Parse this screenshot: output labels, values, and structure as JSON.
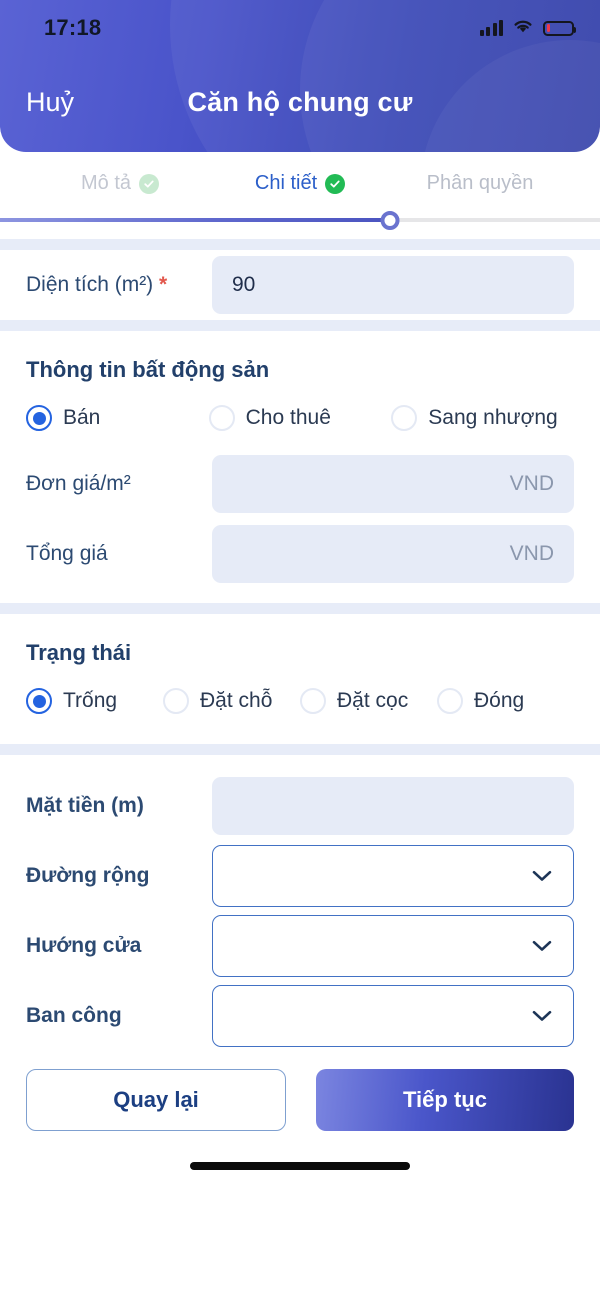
{
  "status_bar": {
    "time": "17:18",
    "signal_icon": "signal-bars-icon",
    "wifi_icon": "wifi-icon",
    "battery_icon": "battery-low-icon",
    "battery_level_percent": 14
  },
  "header": {
    "cancel_label": "Huỷ",
    "title": "Căn hộ chung cư",
    "gradient_from": "#5a63d4",
    "gradient_to": "#2b39a6"
  },
  "stepper": {
    "progress_percent": 65,
    "steps": [
      {
        "label": "Mô tả",
        "state": "done",
        "check_icon": "check-circle-icon"
      },
      {
        "label": "Chi tiết",
        "state": "active",
        "check_icon": "check-circle-icon"
      },
      {
        "label": "Phân quyền",
        "state": "todo",
        "check_icon": ""
      }
    ]
  },
  "area_section": {
    "label": "Diện tích (m²)",
    "required_mark": "*",
    "value": "90"
  },
  "property_section": {
    "title": "Thông tin bất động sản",
    "deal_type": {
      "selected": "Bán",
      "options": [
        {
          "label": "Bán",
          "selected": true
        },
        {
          "label": "Cho thuê",
          "selected": false
        },
        {
          "label": "Sang nhượng",
          "selected": false
        }
      ]
    },
    "fields": [
      {
        "label": "Đơn giá/m²",
        "value": "",
        "suffix": "VND"
      },
      {
        "label": "Tổng giá",
        "value": "",
        "suffix": "VND"
      }
    ]
  },
  "status_section": {
    "title": "Trạng thái",
    "selected": "Trống",
    "options": [
      {
        "label": "Trống",
        "selected": true
      },
      {
        "label": "Đặt chỗ",
        "selected": false
      },
      {
        "label": "Đặt cọc",
        "selected": false
      },
      {
        "label": "Đóng",
        "selected": false
      }
    ]
  },
  "detail_section": {
    "frontage": {
      "label": "Mặt tiền (m)",
      "value": ""
    },
    "selects": [
      {
        "label": "Đường rộng",
        "value": "",
        "icon": "chevron-down-icon"
      },
      {
        "label": "Hướng cửa",
        "value": "",
        "icon": "chevron-down-icon"
      },
      {
        "label": "Ban công",
        "value": "",
        "icon": "chevron-down-icon"
      }
    ]
  },
  "footer": {
    "back_label": "Quay lại",
    "next_label": "Tiếp tục"
  },
  "colors": {
    "accent_blue": "#2463e0",
    "header_blue": "#3b46b8",
    "check_green": "#22bb55",
    "field_fill": "#e6ebf7",
    "required_red": "#e2574c",
    "battery_red": "#f0384a"
  }
}
